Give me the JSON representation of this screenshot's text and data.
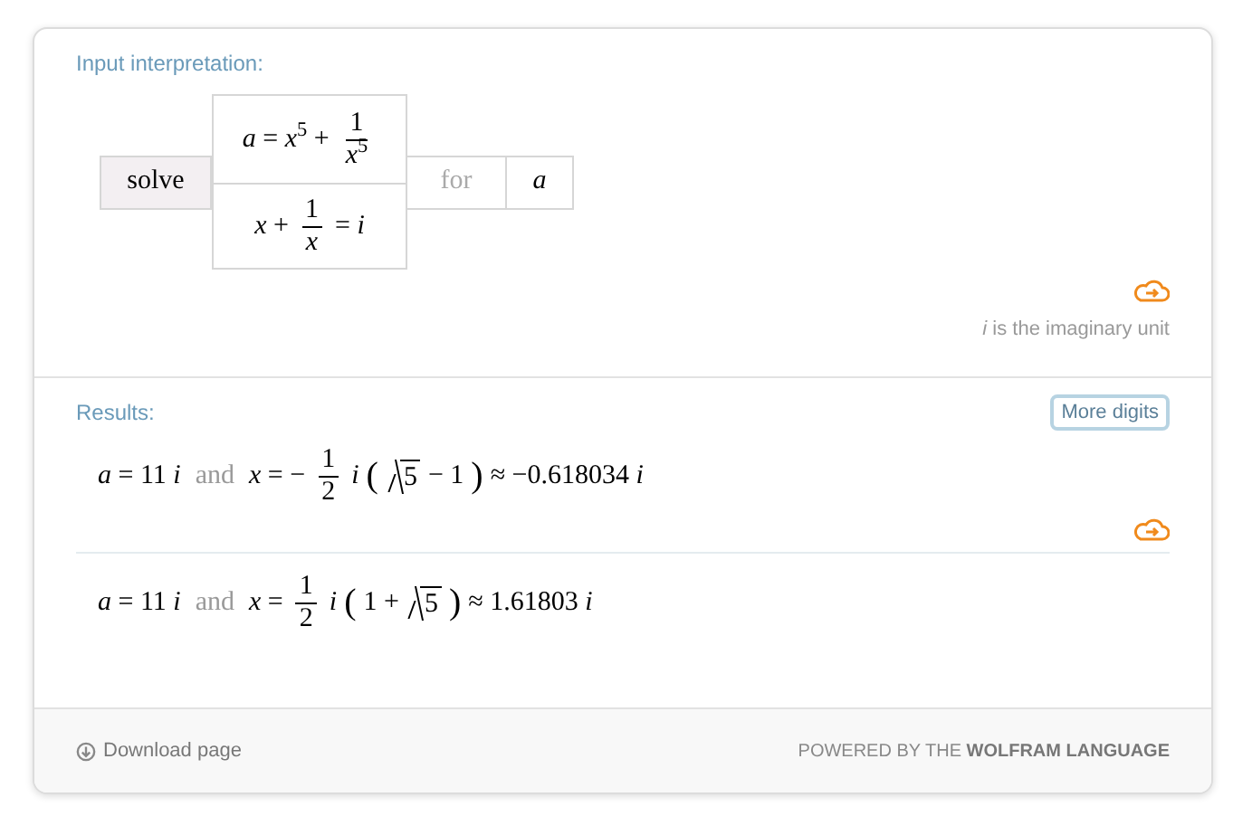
{
  "input_interpretation": {
    "label": "Input interpretation:",
    "solve": "solve",
    "equations": [
      {
        "formula": [
          {
            "kind": "t",
            "text": "*a* = *x*$^{5}$ +"
          },
          {
            "kind": "frac",
            "num": "1",
            "den": "*x*$^{5}$"
          }
        ]
      },
      {
        "formula": [
          {
            "kind": "t",
            "text": "*x* +"
          },
          {
            "kind": "frac",
            "num": "1",
            "den": "*x*"
          },
          {
            "kind": "t",
            "text": "= *i*"
          }
        ]
      }
    ],
    "for": "for",
    "variable": "*a*"
  },
  "note": {
    "symbol": "*i*",
    "text": "is the imaginary unit"
  },
  "results": {
    "label": "Results:",
    "more_digits": "More digits",
    "rows": [
      {
        "formula": [
          {
            "kind": "t",
            "text": "*a* = 11 *i*"
          },
          {
            "kind": "word",
            "text": "and"
          },
          {
            "kind": "t",
            "text": "*x* = −"
          },
          {
            "kind": "frac",
            "num": "1",
            "den": "2"
          },
          {
            "kind": "t",
            "text": "*i*"
          },
          {
            "kind": "paren",
            "text": "("
          },
          {
            "kind": "sqrt",
            "text": "5"
          },
          {
            "kind": "t",
            "text": "− 1"
          },
          {
            "kind": "paren",
            "text": ")"
          },
          {
            "kind": "t",
            "text": "≈ −0.618034 *i*"
          }
        ]
      },
      {
        "formula": [
          {
            "kind": "t",
            "text": "*a* = 11 *i*"
          },
          {
            "kind": "word",
            "text": "and"
          },
          {
            "kind": "t",
            "text": "*x* ="
          },
          {
            "kind": "frac",
            "num": "1",
            "den": "2"
          },
          {
            "kind": "t",
            "text": "*i*"
          },
          {
            "kind": "paren",
            "text": "("
          },
          {
            "kind": "t",
            "text": "1 +"
          },
          {
            "kind": "sqrt",
            "text": "5"
          },
          {
            "kind": "paren",
            "text": ")"
          },
          {
            "kind": "t",
            "text": "≈ 1.61803 *i*"
          }
        ]
      }
    ]
  },
  "footer": {
    "download": "Download page",
    "powered_prefix": "POWERED BY THE",
    "powered_brand": "WOLFRAM LANGUAGE"
  }
}
